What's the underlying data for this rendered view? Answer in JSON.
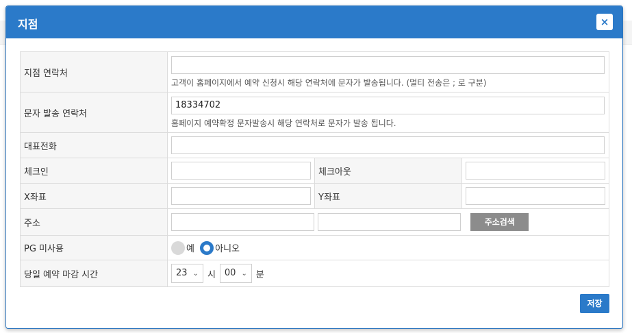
{
  "modal": {
    "title": "지점",
    "close_label": "×",
    "save_label": "저장"
  },
  "form": {
    "branch_contact": {
      "label": "지점 연락처",
      "value": "",
      "help": "고객이 홈페이지에서 예약 신청시 해당 연락처에 문자가 발송됩니다.   (멀티 전송은 ; 로 구분)"
    },
    "sms_contact": {
      "label": "문자 발송 연락처",
      "value": "18334702",
      "help": "홈페이지 예약확정 문자발송시 해당 연락처로 문자가 발송 됩니다."
    },
    "main_phone": {
      "label": "대표전화",
      "value": ""
    },
    "checkin": {
      "label": "체크인",
      "value": ""
    },
    "checkout": {
      "label": "체크아웃",
      "value": ""
    },
    "x_coord": {
      "label": "X좌표",
      "value": ""
    },
    "y_coord": {
      "label": "Y좌표",
      "value": ""
    },
    "address": {
      "label": "주소",
      "value1": "",
      "value2": "",
      "search_label": "주소검색"
    },
    "pg": {
      "label": "PG 미사용",
      "options": [
        "예",
        "아니오"
      ],
      "selected": "아니오"
    },
    "deadline": {
      "label": "당일 예약 마감 시간",
      "hour": "23",
      "hour_unit": "시",
      "minute": "00",
      "minute_unit": "분"
    }
  },
  "colors": {
    "header": "#2b7ac9",
    "label_bg": "#f6f6f6",
    "address_button": "#8c8c8c"
  }
}
